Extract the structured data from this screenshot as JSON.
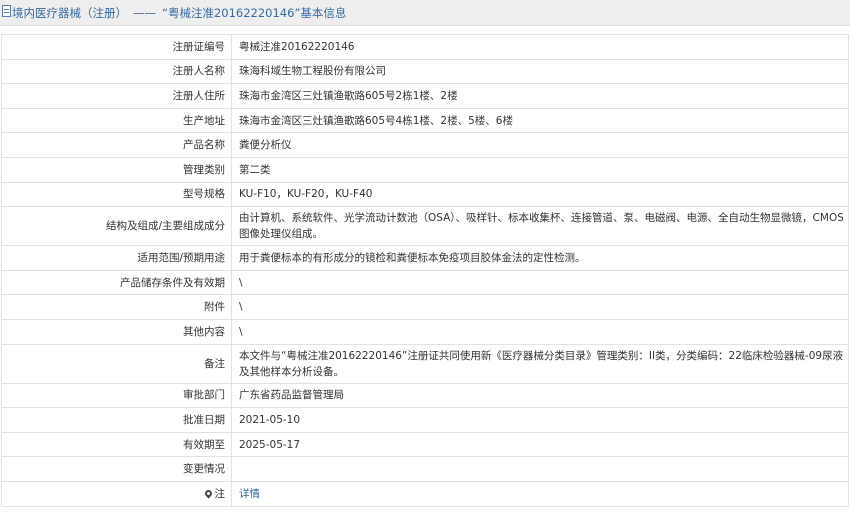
{
  "header": {
    "part1": "境内医疗器械（注册）",
    "separator": "——",
    "part2": "“粤械注准20162220146”基本信息"
  },
  "rows": [
    {
      "label": "注册证编号",
      "value": "粤械注准20162220146"
    },
    {
      "label": "注册人名称",
      "value": "珠海科域生物工程股份有限公司"
    },
    {
      "label": "注册人住所",
      "value": "珠海市金湾区三灶镇渔歌路605号2栋1楼、2楼"
    },
    {
      "label": "生产地址",
      "value": "珠海市金湾区三灶镇渔歌路605号4栋1楼、2楼、5楼、6楼"
    },
    {
      "label": "产品名称",
      "value": "粪便分析仪"
    },
    {
      "label": "管理类别",
      "value": "第二类"
    },
    {
      "label": "型号规格",
      "value": "KU-F10，KU-F20，KU-F40"
    },
    {
      "label": "结构及组成/主要组成成分",
      "value": "由计算机、系统软件、光学流动计数池（OSA）、吸样针、标本收集杯、连接管道、泵、电磁阀、电源、全自动生物显微镜，CMOS图像处理仪组成。"
    },
    {
      "label": "适用范围/预期用途",
      "value": "用于粪便标本的有形成分的镜检和粪便标本免疫项目胶体金法的定性检测。"
    },
    {
      "label": "产品储存条件及有效期",
      "value": "\\"
    },
    {
      "label": "附件",
      "value": "\\"
    },
    {
      "label": "其他内容",
      "value": "\\"
    },
    {
      "label": "备注",
      "value": "本文件与“粤械注准20162220146”注册证共同使用新《医疗器械分类目录》管理类别：II类，分类编码：22临床检验器械-09尿液及其他样本分析设备。"
    },
    {
      "label": "审批部门",
      "value": "广东省药品监督管理局"
    },
    {
      "label": "批准日期",
      "value": "2021-05-10"
    },
    {
      "label": "有效期至",
      "value": "2025-05-17"
    },
    {
      "label": "变更情况",
      "value": ""
    }
  ],
  "note_row": {
    "label": "注",
    "link": "详情",
    "icon": "pin-icon"
  }
}
